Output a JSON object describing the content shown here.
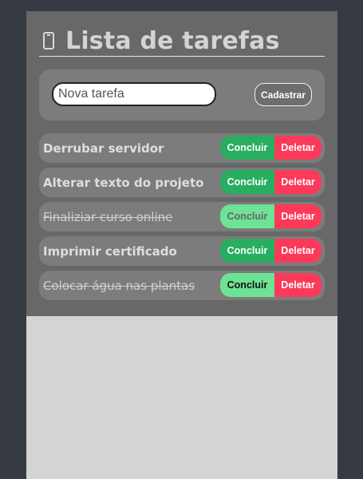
{
  "header": {
    "title": "Lista de tarefas",
    "icon": "phone-icon"
  },
  "form": {
    "placeholder": "Nova tarefa",
    "value": "",
    "add_label": "Cadastrar"
  },
  "tasks": [
    {
      "text": "Derrubar servidor",
      "done": false,
      "conclude_label": "Concluir",
      "delete_label": "Deletar"
    },
    {
      "text": "Alterar texto do projeto",
      "done": false,
      "conclude_label": "Concluir",
      "delete_label": "Deletar"
    },
    {
      "text": "Finaliziar curso online",
      "done": true,
      "conclude_label": "Concluir",
      "delete_label": "Deletar"
    },
    {
      "text": "Imprimir certificado",
      "done": false,
      "conclude_label": "Concluir",
      "delete_label": "Deletar"
    },
    {
      "text": "Colocar água nas plantas",
      "done": true,
      "conclude_label": "Concluir",
      "delete_label": "Deletar"
    }
  ],
  "colors": {
    "page_bg": "#363a42",
    "card_bg": "#686868",
    "panel_bg": "#d4d4d4",
    "conclude": "#27ae60",
    "conclude_done": "#6ee396",
    "delete": "#fb3a5a"
  }
}
